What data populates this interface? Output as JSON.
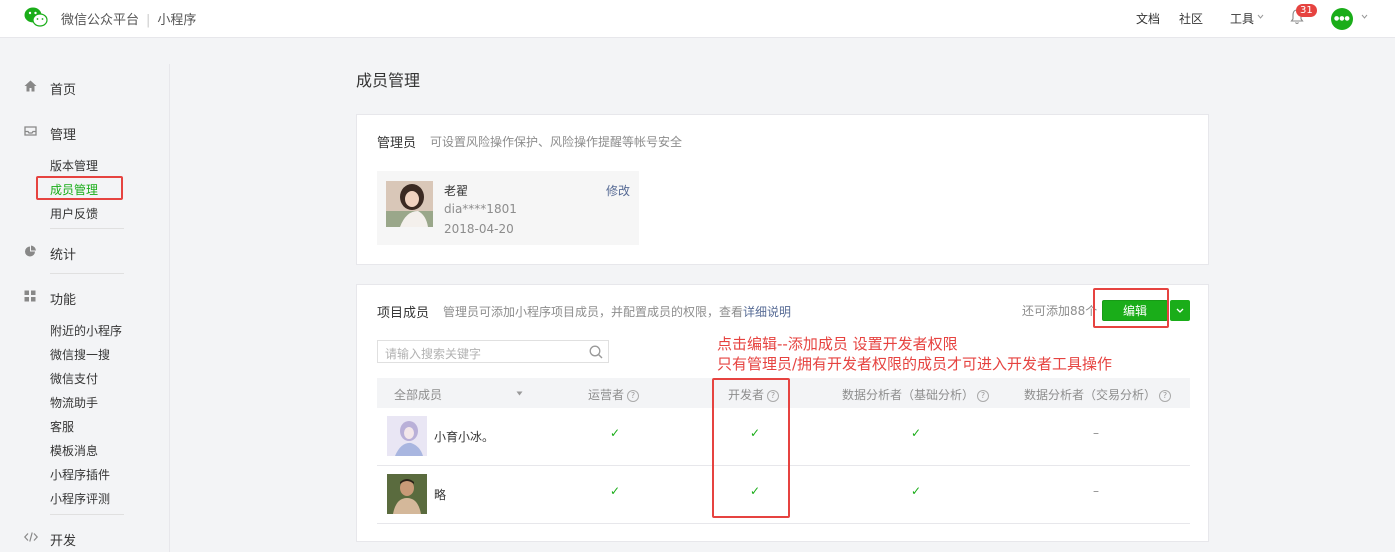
{
  "header": {
    "brand": "微信公众平台",
    "product": "小程序",
    "nav": {
      "docs": "文档",
      "community": "社区",
      "tools": "工具"
    },
    "notification_count": "31"
  },
  "sidebar": {
    "home": "首页",
    "manage": {
      "label": "管理",
      "items": [
        "版本管理",
        "成员管理",
        "用户反馈"
      ]
    },
    "stats": "统计",
    "features": {
      "label": "功能",
      "items": [
        "附近的小程序",
        "微信搜一搜",
        "微信支付",
        "物流助手",
        "客服",
        "模板消息",
        "小程序插件",
        "小程序评测"
      ]
    },
    "develop": "开发"
  },
  "page": {
    "title": "成员管理"
  },
  "admin_card": {
    "title": "管理员",
    "desc": "可设置风险操作保护、风险操作提醒等帐号安全",
    "admin": {
      "name": "老翟",
      "id": "dia****1801",
      "date": "2018-04-20",
      "edit": "修改"
    }
  },
  "members_card": {
    "title": "项目成员",
    "desc": "管理员可添加小程序项目成员，并配置成员的权限，查看",
    "desc_link": "详细说明",
    "quota": "还可添加88个",
    "edit_button": "编辑",
    "search_placeholder": "请输入搜索关键字",
    "columns": [
      "全部成员",
      "运营者",
      "开发者",
      "数据分析者（基础分析）",
      "数据分析者（交易分析）"
    ],
    "rows": [
      {
        "name": "小育小冰。",
        "cells": [
          "✓",
          "✓",
          "✓",
          "–"
        ]
      },
      {
        "name": "略",
        "cells": [
          "✓",
          "✓",
          "✓",
          "–"
        ]
      }
    ]
  },
  "annotation": {
    "line1": "点击编辑--添加成员    设置开发者权限",
    "line2": "只有管理员/拥有开发者权限的成员才可进入开发者工具操作"
  },
  "colors": {
    "accent": "#1aad19",
    "annotation": "#e64340",
    "link": "#576b95"
  }
}
